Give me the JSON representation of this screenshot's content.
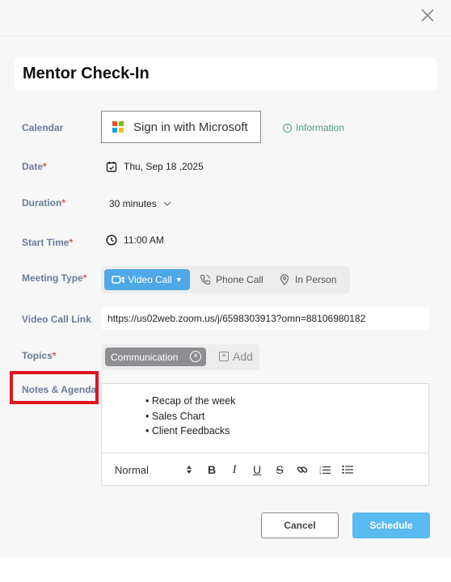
{
  "title": "Mentor Check-In",
  "labels": {
    "calendar": "Calendar",
    "date": "Date",
    "duration": "Duration",
    "start_time": "Start Time",
    "meeting_type": "Meeting Type",
    "video_link": "Video Call Link",
    "topics": "Topics",
    "notes": "Notes & Agenda",
    "required_mark": "*"
  },
  "calendar": {
    "ms_button": "Sign in with Microsoft",
    "info": "Information",
    "ms_colors": [
      "#f25022",
      "#7fba00",
      "#00a4ef",
      "#ffb900"
    ]
  },
  "date": {
    "value": "Thu, Sep 18 ,2025",
    "icon": "calendar-icon"
  },
  "duration": {
    "value": "30 minutes"
  },
  "start_time": {
    "value": "11:00 AM",
    "icon": "clock-icon"
  },
  "meeting_type": {
    "options": [
      {
        "label": "Video Call",
        "icon": "video-icon"
      },
      {
        "label": "Phone Call",
        "icon": "phone-icon"
      },
      {
        "label": "In Person",
        "icon": "location-pin-icon"
      }
    ],
    "selected": "Video Call"
  },
  "video_link": {
    "value": "https://us02web.zoom.us/j/6598303913?omn=88106980182"
  },
  "topics": {
    "chips": [
      "Communication"
    ],
    "add_label": "Add"
  },
  "notes": {
    "items": [
      "Recap of the week",
      "Sales Chart",
      "Client Feedbacks"
    ],
    "format": "Normal"
  },
  "buttons": {
    "cancel": "Cancel",
    "schedule": "Schedule"
  },
  "colors": {
    "accent": "#4fa8e5",
    "label": "#6b7b99",
    "required": "#d9534f",
    "highlight": "#e0141c"
  }
}
